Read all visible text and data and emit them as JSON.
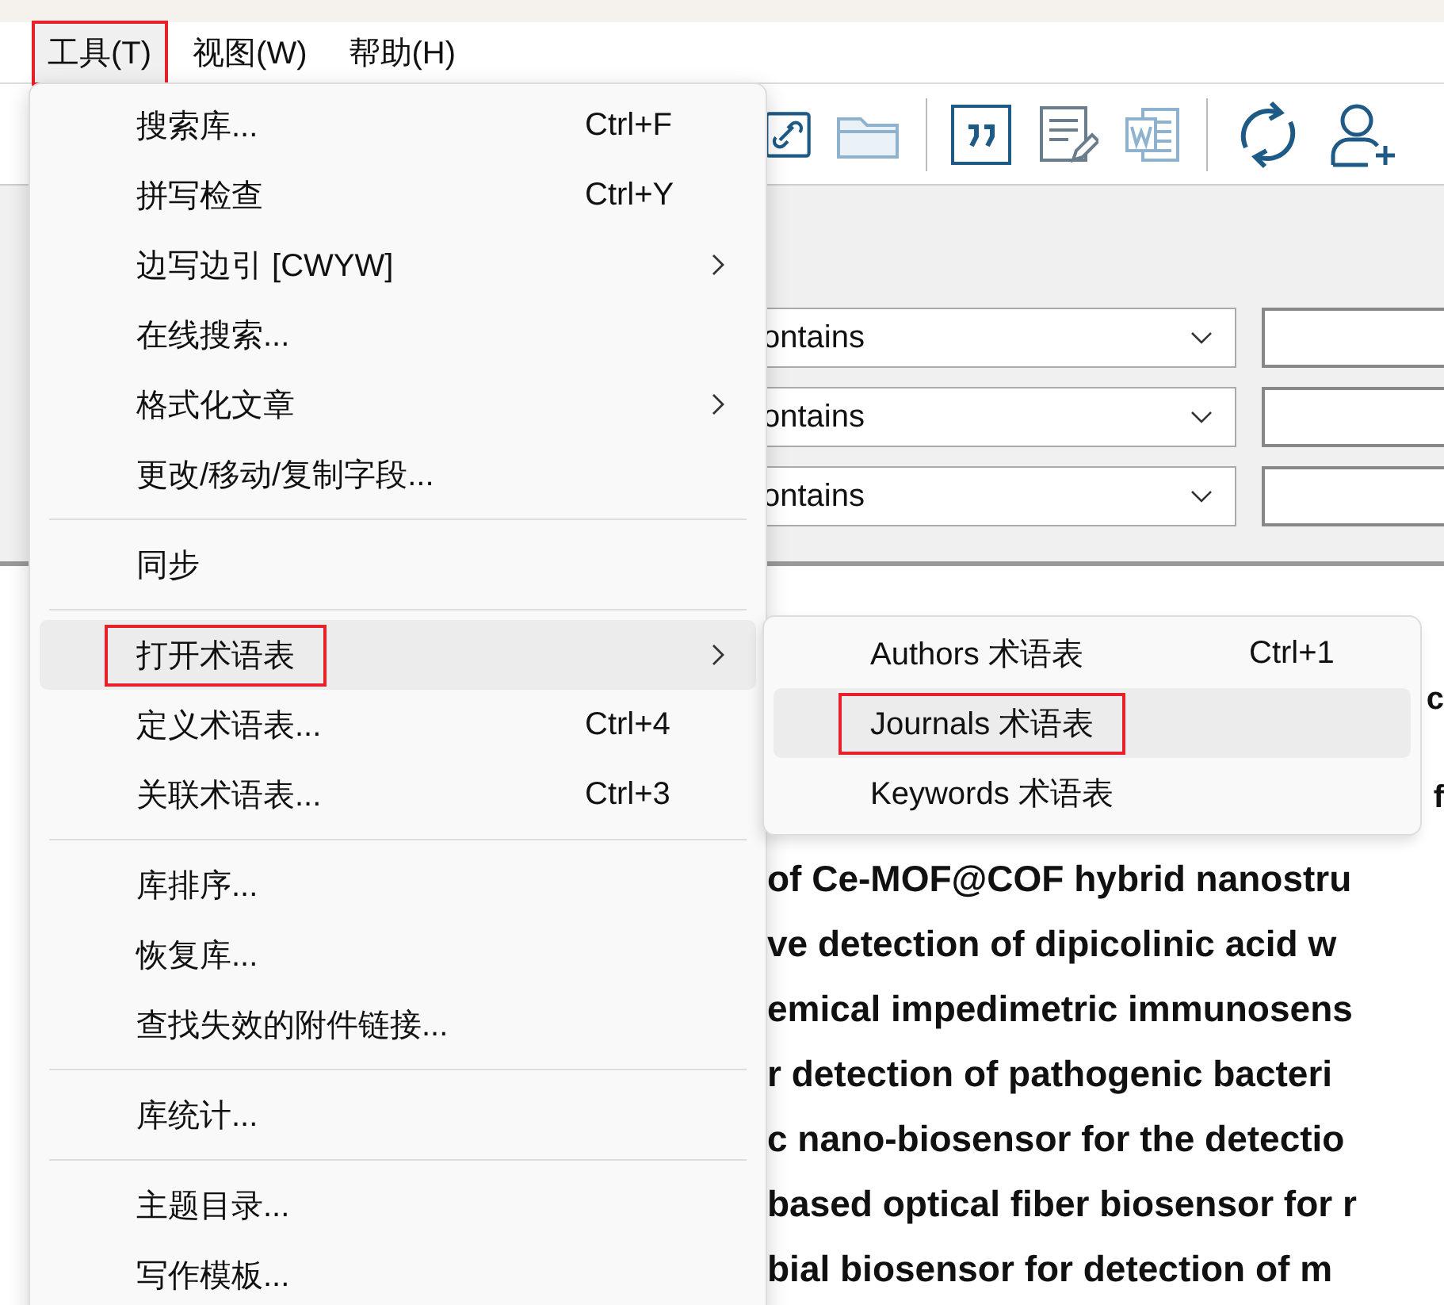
{
  "menubar": [
    {
      "label": "工具(T)",
      "selected": true,
      "outlined": true
    },
    {
      "label": "视图(W)",
      "selected": false,
      "outlined": false
    },
    {
      "label": "帮助(H)",
      "selected": false,
      "outlined": false
    }
  ],
  "search_panel": {
    "rows": [
      {
        "operator": "ontains"
      },
      {
        "operator": "ontains"
      },
      {
        "operator": "ontains"
      }
    ]
  },
  "references": [
    {
      "kind": "edge",
      "text": "c"
    },
    {
      "kind": "edge",
      "text": "f"
    },
    {
      "kind": "line",
      "text": "of Ce-MOF@COF hybrid nanostru"
    },
    {
      "kind": "line",
      "text": "ve detection of dipicolinic acid w"
    },
    {
      "kind": "line",
      "text": "emical impedimetric immunosens"
    },
    {
      "kind": "line",
      "text": "r detection of pathogenic bacteri"
    },
    {
      "kind": "line",
      "text": "c nano-biosensor for the detectio"
    },
    {
      "kind": "line",
      "text": "based optical fiber biosensor for r"
    },
    {
      "kind": "line",
      "text": "bial biosensor for detection of m"
    }
  ],
  "menu": [
    {
      "kind": "item",
      "label": "搜索库...",
      "shortcut": "Ctrl+F",
      "submenu": false,
      "selected": false,
      "outlined": false
    },
    {
      "kind": "item",
      "label": "拼写检查",
      "shortcut": "Ctrl+Y",
      "submenu": false,
      "selected": false,
      "outlined": false
    },
    {
      "kind": "item",
      "label": "边写边引 [CWYW]",
      "submenu": true,
      "selected": false,
      "outlined": false
    },
    {
      "kind": "item",
      "label": "在线搜索...",
      "submenu": false,
      "selected": false,
      "outlined": false
    },
    {
      "kind": "item",
      "label": "格式化文章",
      "submenu": true,
      "selected": false,
      "outlined": false
    },
    {
      "kind": "item",
      "label": "更改/移动/复制字段...",
      "submenu": false,
      "selected": false,
      "outlined": false
    },
    {
      "kind": "separator"
    },
    {
      "kind": "item",
      "label": "同步",
      "submenu": false,
      "selected": false,
      "outlined": false
    },
    {
      "kind": "separator"
    },
    {
      "kind": "item",
      "label": "打开术语表",
      "submenu": true,
      "selected": true,
      "outlined": true
    },
    {
      "kind": "item",
      "label": "定义术语表...",
      "shortcut": "Ctrl+4",
      "submenu": false,
      "selected": false,
      "outlined": false
    },
    {
      "kind": "item",
      "label": "关联术语表...",
      "shortcut": "Ctrl+3",
      "submenu": false,
      "selected": false,
      "outlined": false
    },
    {
      "kind": "separator"
    },
    {
      "kind": "item",
      "label": "库排序...",
      "submenu": false,
      "selected": false,
      "outlined": false
    },
    {
      "kind": "item",
      "label": "恢复库...",
      "submenu": false,
      "selected": false,
      "outlined": false
    },
    {
      "kind": "item",
      "label": "查找失效的附件链接...",
      "submenu": false,
      "selected": false,
      "outlined": false
    },
    {
      "kind": "separator"
    },
    {
      "kind": "item",
      "label": "库统计...",
      "submenu": false,
      "selected": false,
      "outlined": false
    },
    {
      "kind": "separator"
    },
    {
      "kind": "item",
      "label": "主题目录...",
      "submenu": false,
      "selected": false,
      "outlined": false
    },
    {
      "kind": "item",
      "label": "写作模板...",
      "submenu": false,
      "selected": false,
      "outlined": false
    }
  ],
  "submenu": [
    {
      "label": "Authors 术语表",
      "shortcut": "Ctrl+1",
      "selected": false,
      "outlined": false
    },
    {
      "label": "Journals 术语表",
      "selected": true,
      "outlined": true
    },
    {
      "label": "Keywords 术语表",
      "selected": false,
      "outlined": false
    }
  ]
}
